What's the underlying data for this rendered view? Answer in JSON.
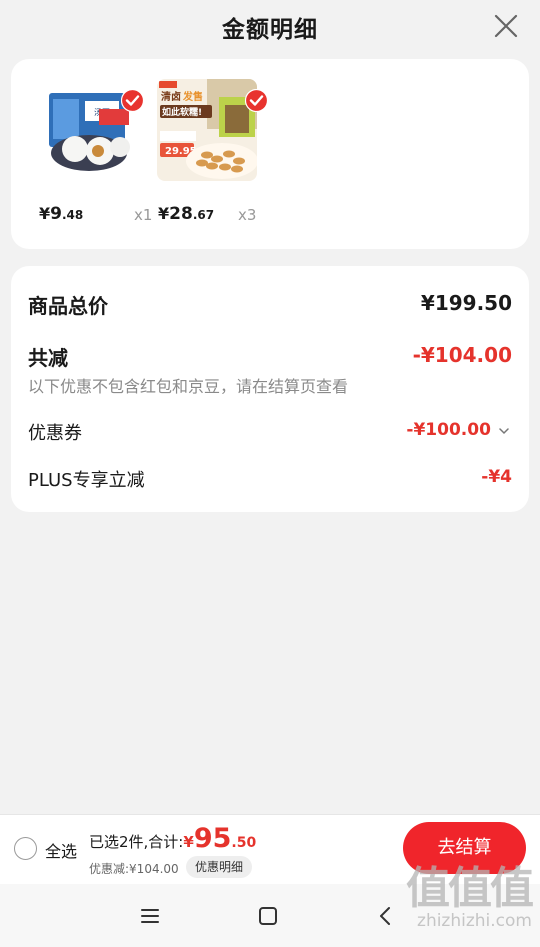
{
  "header": {
    "title": "金额明细"
  },
  "products": [
    {
      "name_icon": "frozen-dumplings-image",
      "price_symbol": "¥",
      "price_int": "9",
      "price_dec": ".48",
      "qty": "x1"
    },
    {
      "name_icon": "cashew-snack-image",
      "price_symbol": "¥",
      "price_int": "28",
      "price_dec": ".67",
      "qty": "x3",
      "img_text_1": "清卤",
      "img_text_1b": "发售",
      "img_text_2": "如此软糯!",
      "img_price": "29.95"
    }
  ],
  "detail": {
    "total_label": "商品总价",
    "total_value": "¥199.50",
    "discount_label": "共减",
    "discount_value": "-¥104.00",
    "discount_note": "以下优惠不包含红包和京豆，请在结算页查看",
    "coupon_label": "优惠券",
    "coupon_value": "-¥100.00",
    "plus_label": "PLUS专享立减",
    "plus_value": "-¥4"
  },
  "bottom": {
    "select_all": "全选",
    "summary_prefix": "已选2件,合计:",
    "total_symbol": "¥",
    "total_int": "95",
    "total_dec": ".50",
    "saving": "优惠减:¥104.00",
    "detail_pill": "优惠明细",
    "checkout": "去结算"
  },
  "watermark": {
    "big": "值值值",
    "small": "zhizhizhi.com"
  },
  "colors": {
    "accent_red": "#e5332c",
    "button_red": "#f0252b",
    "badge_red": "#e8332e"
  }
}
